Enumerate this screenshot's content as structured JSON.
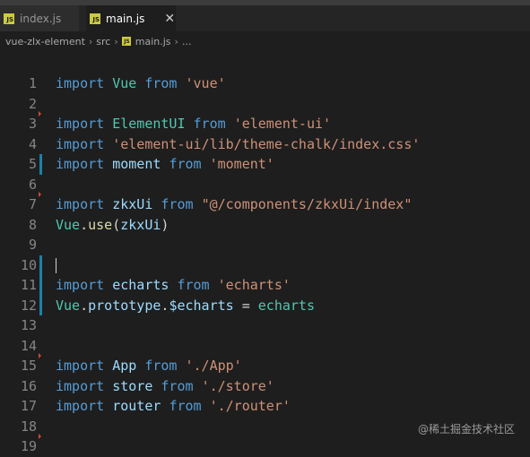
{
  "tabs": [
    {
      "label": "index.js",
      "active": false
    },
    {
      "label": "main.js",
      "active": true
    }
  ],
  "close_glyph": "✕",
  "breadcrumb": [
    "vue-zlx-element",
    "src",
    "main.js",
    "..."
  ],
  "code": [
    {
      "n": "1",
      "marker": "",
      "tokens": [
        [
          "kw",
          "import"
        ],
        [
          "punc",
          " "
        ],
        [
          "ty",
          "Vue"
        ],
        [
          "punc",
          " "
        ],
        [
          "kw",
          "from"
        ],
        [
          "punc",
          " "
        ],
        [
          "str",
          "'vue'"
        ]
      ]
    },
    {
      "n": "2",
      "marker": "",
      "tokens": []
    },
    {
      "n": "3",
      "marker": "del",
      "tokens": [
        [
          "kw",
          "import"
        ],
        [
          "punc",
          " "
        ],
        [
          "ty",
          "ElementUI"
        ],
        [
          "punc",
          " "
        ],
        [
          "kw",
          "from"
        ],
        [
          "punc",
          " "
        ],
        [
          "str",
          "'element-ui'"
        ]
      ]
    },
    {
      "n": "4",
      "marker": "",
      "tokens": [
        [
          "kw",
          "import"
        ],
        [
          "punc",
          " "
        ],
        [
          "str",
          "'element-ui/lib/theme-chalk/index.css'"
        ]
      ]
    },
    {
      "n": "5",
      "marker": "mod",
      "tokens": [
        [
          "kw",
          "import"
        ],
        [
          "punc",
          " "
        ],
        [
          "id",
          "moment"
        ],
        [
          "punc",
          " "
        ],
        [
          "kw",
          "from"
        ],
        [
          "punc",
          " "
        ],
        [
          "str",
          "'moment'"
        ]
      ]
    },
    {
      "n": "6",
      "marker": "",
      "tokens": []
    },
    {
      "n": "7",
      "marker": "del",
      "tokens": [
        [
          "kw",
          "import"
        ],
        [
          "punc",
          " "
        ],
        [
          "id",
          "zkxUi"
        ],
        [
          "punc",
          " "
        ],
        [
          "kw",
          "from"
        ],
        [
          "punc",
          " "
        ],
        [
          "str",
          "\"@/components/zkxUi/index\""
        ]
      ]
    },
    {
      "n": "8",
      "marker": "",
      "tokens": [
        [
          "ty",
          "Vue"
        ],
        [
          "punc",
          "."
        ],
        [
          "fn",
          "use"
        ],
        [
          "punc",
          "("
        ],
        [
          "id",
          "zkxUi"
        ],
        [
          "punc",
          ")"
        ]
      ]
    },
    {
      "n": "9",
      "marker": "",
      "tokens": []
    },
    {
      "n": "10",
      "marker": "mod",
      "tokens": [],
      "cursor": true
    },
    {
      "n": "11",
      "marker": "mod",
      "tokens": [
        [
          "kw",
          "import"
        ],
        [
          "punc",
          " "
        ],
        [
          "id",
          "echarts"
        ],
        [
          "punc",
          " "
        ],
        [
          "kw",
          "from"
        ],
        [
          "punc",
          " "
        ],
        [
          "str",
          "'echarts'"
        ]
      ]
    },
    {
      "n": "12",
      "marker": "mod",
      "tokens": [
        [
          "ty",
          "Vue"
        ],
        [
          "punc",
          "."
        ],
        [
          "id",
          "prototype"
        ],
        [
          "punc",
          "."
        ],
        [
          "id",
          "$echarts"
        ],
        [
          "punc",
          " = "
        ],
        [
          "ty",
          "echarts"
        ]
      ]
    },
    {
      "n": "13",
      "marker": "",
      "tokens": []
    },
    {
      "n": "14",
      "marker": "",
      "tokens": []
    },
    {
      "n": "15",
      "marker": "del",
      "tokens": [
        [
          "kw",
          "import"
        ],
        [
          "punc",
          " "
        ],
        [
          "id",
          "App"
        ],
        [
          "punc",
          " "
        ],
        [
          "kw",
          "from"
        ],
        [
          "punc",
          " "
        ],
        [
          "str",
          "'./App'"
        ]
      ]
    },
    {
      "n": "16",
      "marker": "",
      "tokens": [
        [
          "kw",
          "import"
        ],
        [
          "punc",
          " "
        ],
        [
          "id",
          "store"
        ],
        [
          "punc",
          " "
        ],
        [
          "kw",
          "from"
        ],
        [
          "punc",
          " "
        ],
        [
          "str",
          "'./store'"
        ]
      ]
    },
    {
      "n": "17",
      "marker": "",
      "tokens": [
        [
          "kw",
          "import"
        ],
        [
          "punc",
          " "
        ],
        [
          "id",
          "router"
        ],
        [
          "punc",
          " "
        ],
        [
          "kw",
          "from"
        ],
        [
          "punc",
          " "
        ],
        [
          "str",
          "'./router'"
        ]
      ]
    },
    {
      "n": "18",
      "marker": "",
      "tokens": []
    },
    {
      "n": "19",
      "marker": "del",
      "tokens": []
    }
  ],
  "watermark": "@稀土掘金技术社区",
  "colors": {
    "keyword": "#569cd6",
    "string": "#ce9178",
    "variable": "#9cdcfe",
    "type": "#4ec9b0",
    "function": "#dcdcaa",
    "gutter_modified": "#1b81a8",
    "gutter_deleted": "#c74e39"
  }
}
